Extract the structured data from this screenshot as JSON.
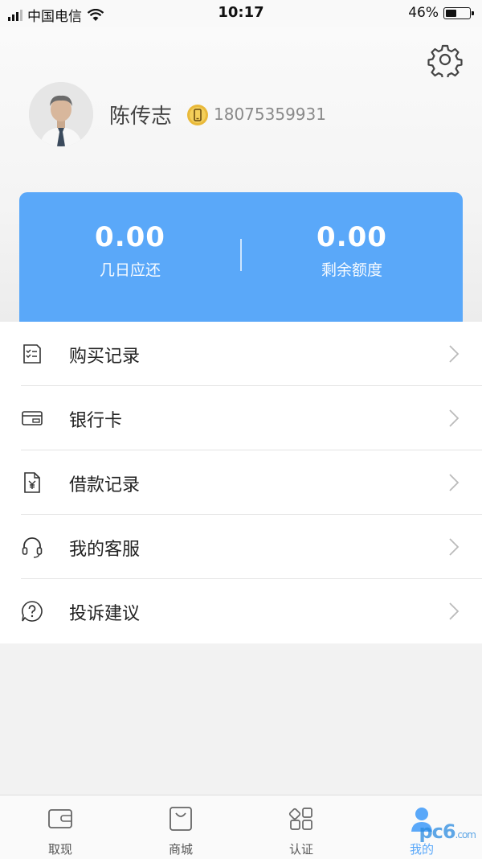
{
  "status_bar": {
    "carrier": "中国电信",
    "time": "10:17",
    "battery_percent": "46%",
    "battery_level": 0.46
  },
  "profile": {
    "name": "陈传志",
    "phone": "18075359931"
  },
  "summary": {
    "left": {
      "value": "0.00",
      "label": "几日应还"
    },
    "right": {
      "value": "0.00",
      "label": "剩余额度"
    },
    "accent_color": "#5aa8f9"
  },
  "menu": [
    {
      "icon": "purchase-record-icon",
      "label": "购买记录"
    },
    {
      "icon": "bank-card-icon",
      "label": "银行卡"
    },
    {
      "icon": "loan-record-icon",
      "label": "借款记录"
    },
    {
      "icon": "headset-icon",
      "label": "我的客服"
    },
    {
      "icon": "question-icon",
      "label": "投诉建议"
    }
  ],
  "tabs": [
    {
      "icon": "wallet-icon",
      "label": "取现"
    },
    {
      "icon": "shopping-bag-icon",
      "label": "商城"
    },
    {
      "icon": "grid-icon",
      "label": "认证"
    },
    {
      "icon": "person-icon",
      "label": "我的",
      "active": true
    }
  ],
  "watermark": {
    "text": "pc6",
    "suffix": ".com"
  }
}
